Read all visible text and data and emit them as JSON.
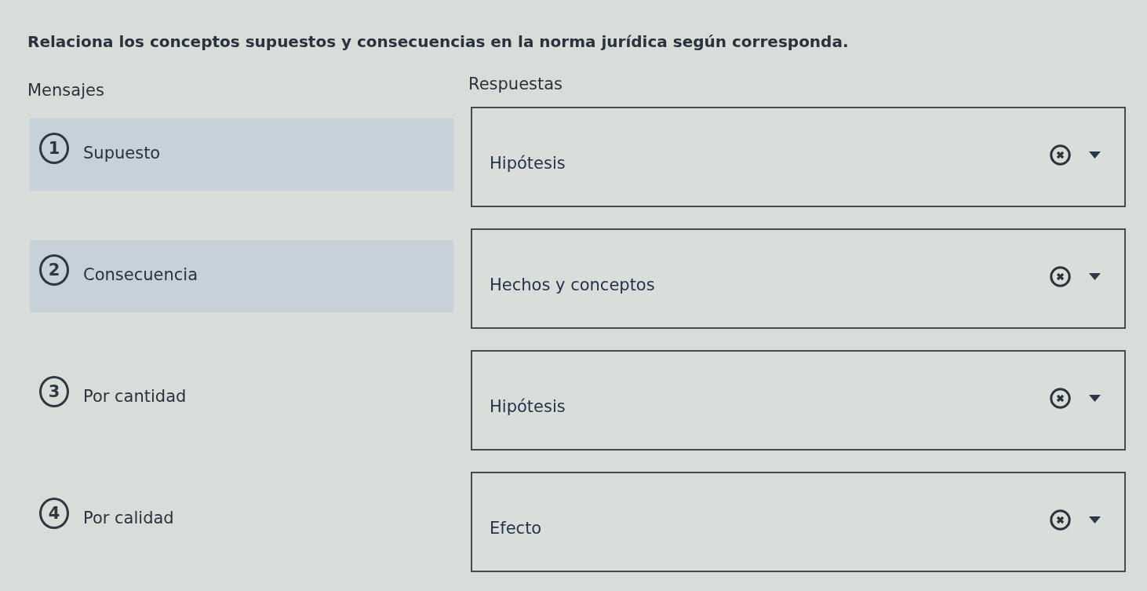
{
  "instruction": "Relaciona los conceptos supuestos y consecuencias en la norma jurídica según corresponda.",
  "messages": {
    "heading": "Mensajes",
    "items": [
      {
        "number": "1",
        "text": "Supuesto",
        "highlighted": true
      },
      {
        "number": "2",
        "text": "Consecuencia",
        "highlighted": true
      },
      {
        "number": "3",
        "text": "Por cantidad",
        "highlighted": false
      },
      {
        "number": "4",
        "text": "Por calidad",
        "highlighted": false
      }
    ]
  },
  "answers": {
    "heading": "Respuestas",
    "items": [
      {
        "value": "Hipótesis"
      },
      {
        "value": "Hechos y conceptos"
      },
      {
        "value": "Hipótesis"
      },
      {
        "value": "Efecto"
      }
    ]
  }
}
